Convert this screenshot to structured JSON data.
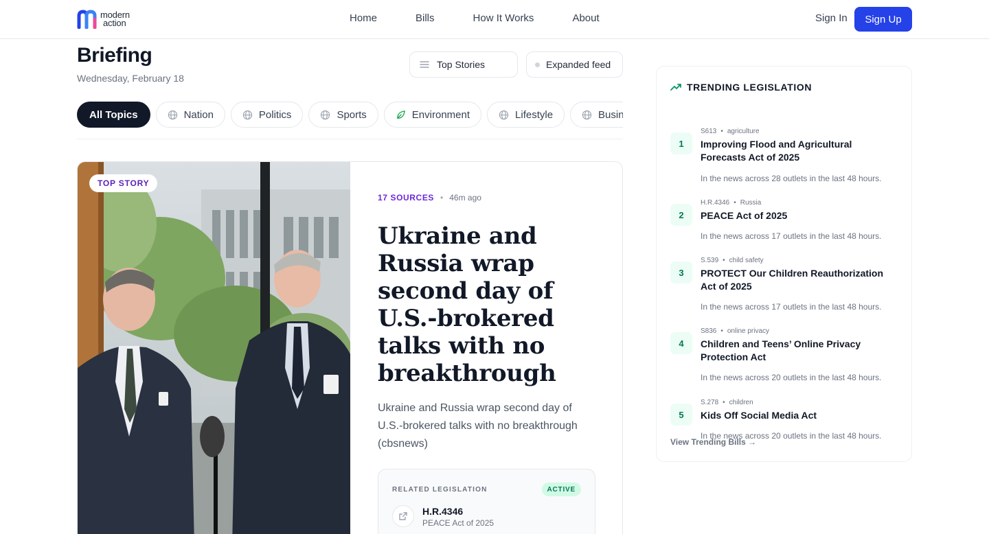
{
  "nav": {
    "logo_line1": "modern",
    "logo_line2": "action",
    "links": [
      "Home",
      "Bills",
      "How It Works",
      "About"
    ],
    "sign_in": "Sign In",
    "sign_up": "Sign Up",
    "accent": "#2541e8"
  },
  "header": {
    "title": "Briefing",
    "date": "Wednesday, February 18",
    "sort_button": "Top Stories",
    "feed_button": "Expanded feed"
  },
  "topics": [
    {
      "label": "All Topics",
      "active": true,
      "icon": "none"
    },
    {
      "label": "Nation",
      "active": false,
      "icon": "globe-icon"
    },
    {
      "label": "Politics",
      "active": false,
      "icon": "globe-icon"
    },
    {
      "label": "Sports",
      "active": false,
      "icon": "globe-icon"
    },
    {
      "label": "Environment",
      "active": false,
      "icon": "leaf-icon"
    },
    {
      "label": "Lifestyle",
      "active": false,
      "icon": "globe-icon"
    },
    {
      "label": "Business",
      "active": false,
      "icon": "globe-icon"
    }
  ],
  "story": {
    "badge": "TOP STORY",
    "sources": "17 SOURCES",
    "separator": "•",
    "time_ago": "46m ago",
    "headline": "Ukraine and Russia wrap second day of U.S.-brokered talks with no breakthrough",
    "summary": "Ukraine and Russia wrap second day of U.S.-brokered talks with no breakthrough (cbsnews)",
    "related": {
      "label": "RELATED LEGISLATION",
      "status": "ACTIVE",
      "bill_id": "H.R.4346",
      "bill_name": "PEACE Act of 2025"
    }
  },
  "trending": {
    "heading": "TRENDING LEGISLATION",
    "items": [
      {
        "rank": "1",
        "code": "S613",
        "tag": "agriculture",
        "title": "Improving Flood and Agricultural Forecasts Act of 2025",
        "desc": "In the news across 28 outlets in the last 48 hours."
      },
      {
        "rank": "2",
        "code": "H.R.4346",
        "tag": "Russia",
        "title": "PEACE Act of 2025",
        "desc": "In the news across 17 outlets in the last 48 hours."
      },
      {
        "rank": "3",
        "code": "S.539",
        "tag": "child safety",
        "title": "PROTECT Our Children Reauthorization Act of 2025",
        "desc": "In the news across 17 outlets in the last 48 hours."
      },
      {
        "rank": "4",
        "code": "S836",
        "tag": "online privacy",
        "title": "Children and Teens’ Online Privacy Protection Act",
        "desc": "In the news across 20 outlets in the last 48 hours."
      },
      {
        "rank": "5",
        "code": "S.278",
        "tag": "children",
        "title": "Kids Off Social Media Act",
        "desc": "In the news across 20 outlets in the last 48 hours."
      }
    ],
    "view_all": "View Trending Bills →"
  }
}
